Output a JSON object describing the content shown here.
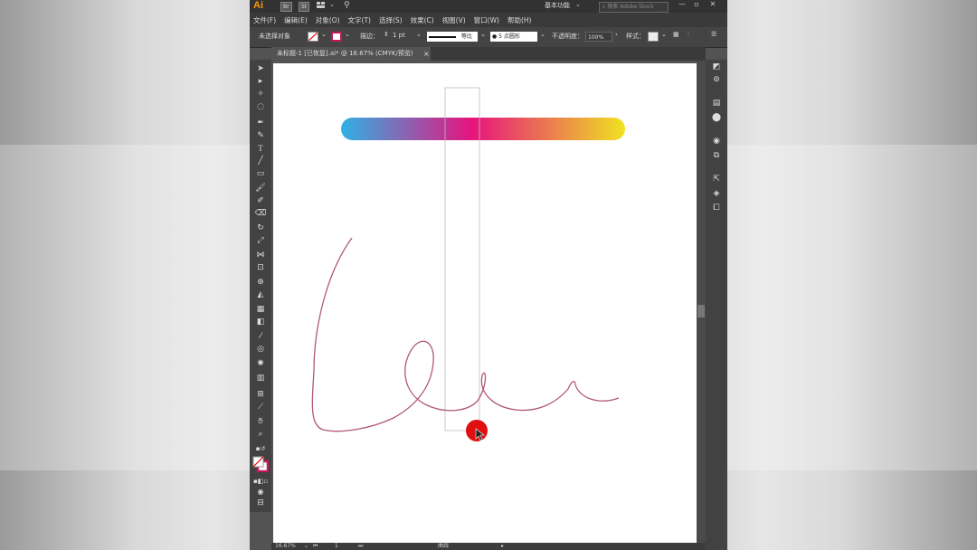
{
  "app": {
    "logo": "Ai",
    "chips": [
      "Br",
      "St"
    ],
    "workspace": "基本功能",
    "stock_search_placeholder": "搜索 Adobe Stock",
    "window_buttons": [
      "—",
      "▫",
      "✕"
    ]
  },
  "menu": [
    "文件(F)",
    "编辑(E)",
    "对象(O)",
    "文字(T)",
    "选择(S)",
    "效果(C)",
    "视图(V)",
    "窗口(W)",
    "帮助(H)"
  ],
  "control_bar": {
    "no_selection": "未选择对象",
    "stroke_label": "描边：",
    "stroke_value": "1 pt",
    "profile": "等比",
    "brush_dot": "●",
    "brush": "5 点圆形",
    "opacity_label": "不透明度：",
    "opacity_value": "100%",
    "style_label": "样式："
  },
  "tab": {
    "title": "未标题-1 [已恢复].ai* @ 16.67% (CMYK/预览)",
    "close": "×"
  },
  "status": {
    "zoom": "16.67%",
    "page": "1",
    "tool": "曲线"
  },
  "colors": {
    "gradient": [
      "#2fb2e4",
      "#e6147e",
      "#f0e221"
    ],
    "curve": "#b0577e",
    "cursor_dot": "#e11010"
  }
}
